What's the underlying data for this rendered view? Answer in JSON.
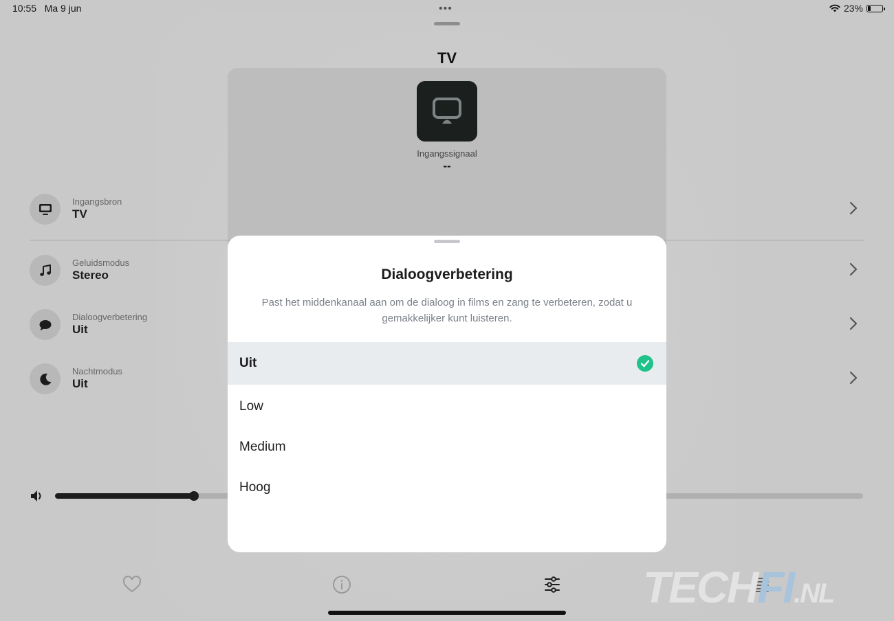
{
  "status_bar": {
    "time": "10:55",
    "date": "Ma 9 jun",
    "battery": "23%",
    "battery_level": 0.23
  },
  "header": {
    "title": "TV"
  },
  "input_card": {
    "label": "Ingangssignaal",
    "value": "--",
    "icon": "tv-icon"
  },
  "settings": [
    {
      "label": "Ingangsbron",
      "value": "TV",
      "icon": "tv-icon"
    },
    {
      "label": "Geluidsmodus",
      "value": "Stereo",
      "icon": "music-note-icon"
    },
    {
      "label": "Dialoogverbetering",
      "value": "Uit",
      "icon": "speech-bubble-icon"
    },
    {
      "label": "Nachtmodus",
      "value": "Uit",
      "icon": "moon-icon"
    }
  ],
  "volume": {
    "level": 0.172
  },
  "tabs": [
    {
      "name": "favorites",
      "icon": "heart-icon"
    },
    {
      "name": "info",
      "icon": "info-icon"
    },
    {
      "name": "settings",
      "icon": "sliders-icon",
      "active": true
    },
    {
      "name": "queue",
      "icon": "list-icon"
    }
  ],
  "sheet": {
    "title": "Dialoogverbetering",
    "description": "Past het middenkanaal aan om de dialoog in films en zang te verbeteren, zodat u gemakkelijker kunt luisteren.",
    "options": [
      "Uit",
      "Low",
      "Medium",
      "Hoog"
    ],
    "selected": "Uit"
  },
  "watermark": {
    "part1": "TECH",
    "part2": "FI",
    "part3": ".NL"
  },
  "colors": {
    "accent_check": "#1fc38a",
    "sheet_bg": "#ffffff",
    "dim_bg": "#c9c9c9"
  }
}
